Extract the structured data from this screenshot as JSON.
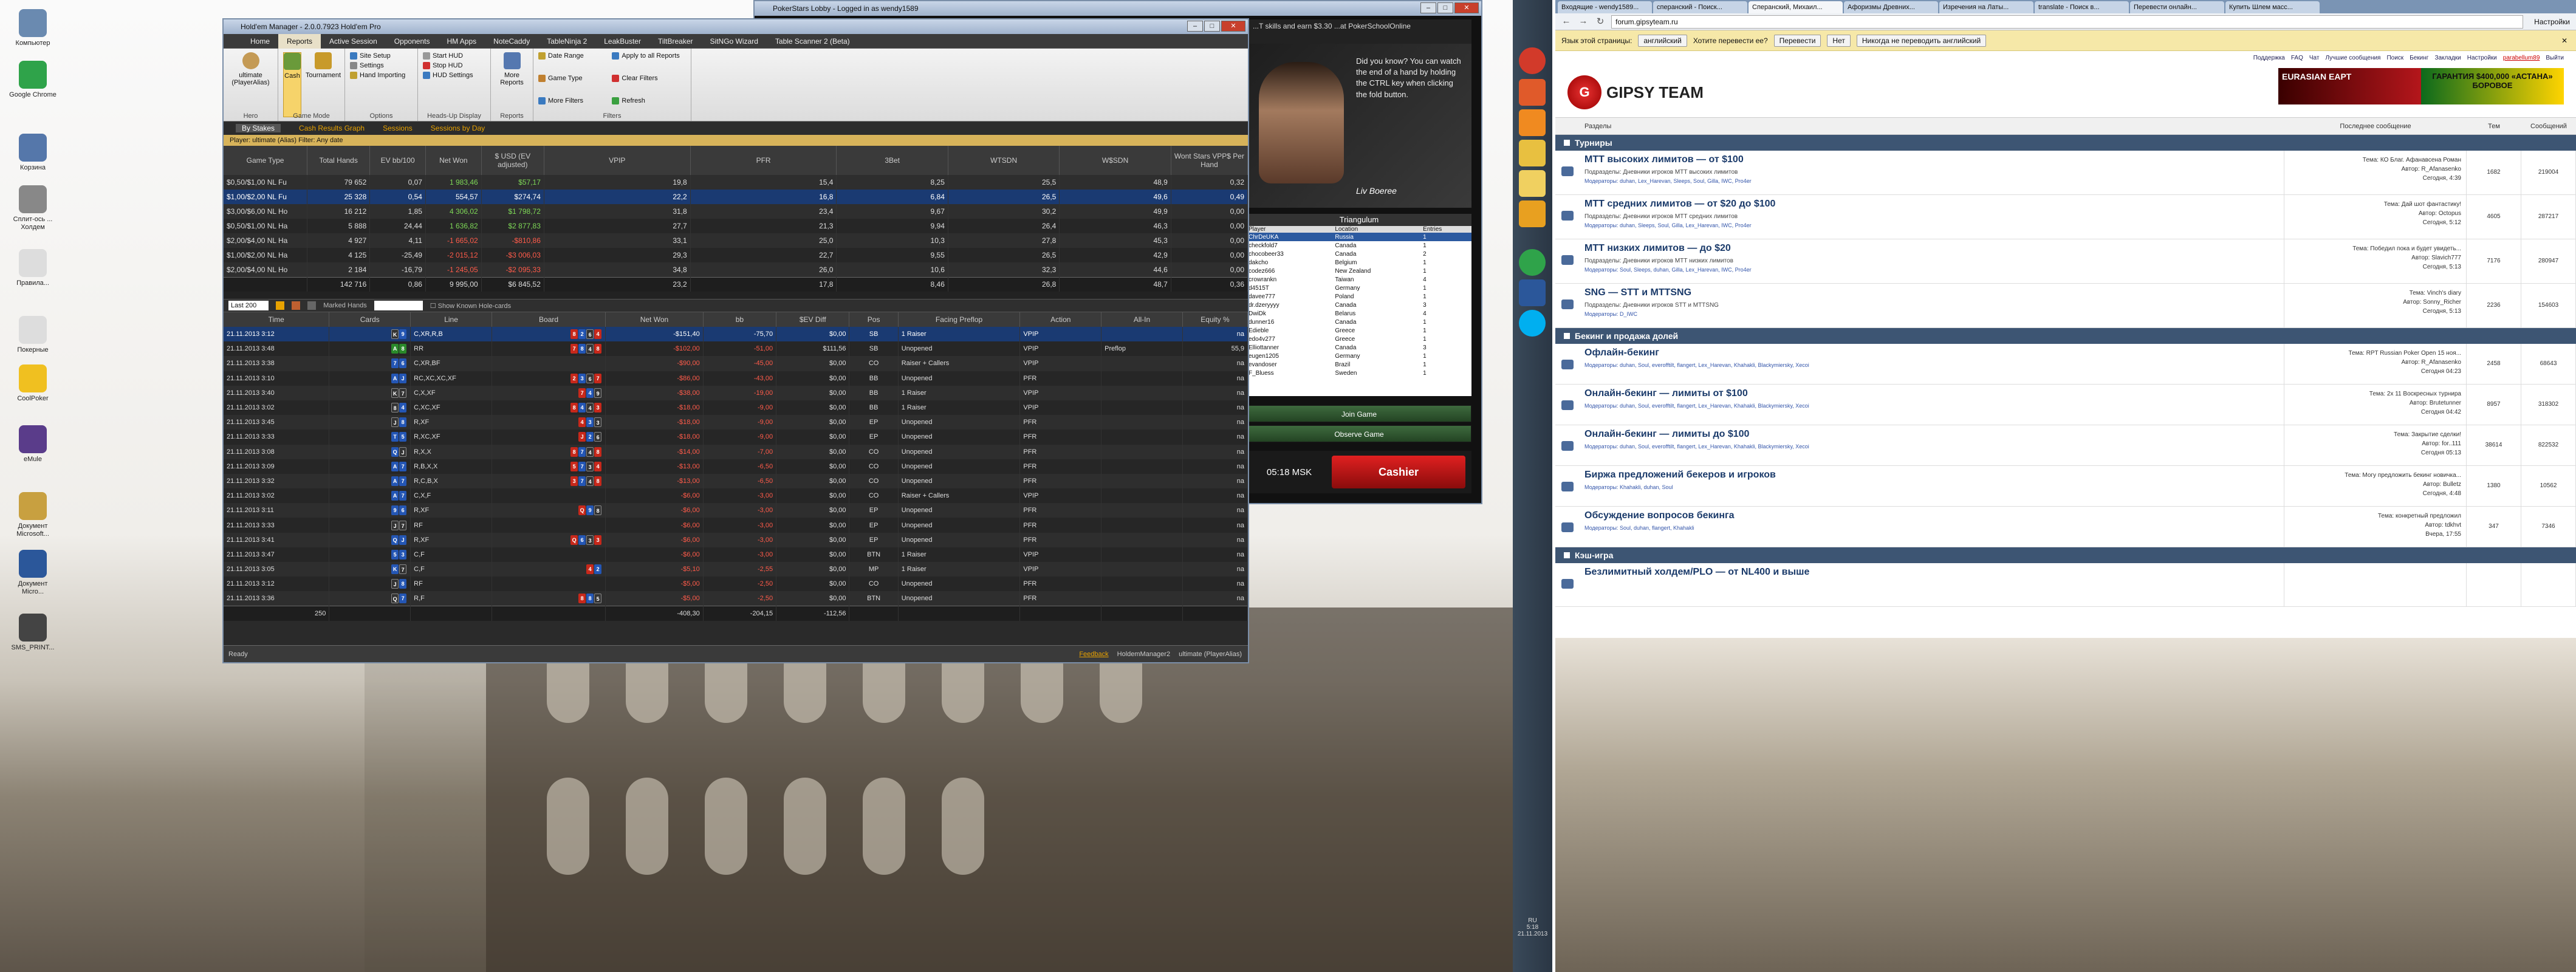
{
  "desktop": {
    "icons": [
      {
        "label": "Компьютер",
        "color": "#6a8ab0"
      },
      {
        "label": "Google Chrome",
        "color": "#2fa34a"
      },
      {
        "label": "Корзина",
        "color": "#5577aa"
      },
      {
        "label": "Сплит-ось ... Холдем",
        "color": "#888"
      },
      {
        "label": "Правила...",
        "color": "#ddd"
      },
      {
        "label": "Покерные",
        "color": "#ddd"
      },
      {
        "label": "CoolPoker",
        "color": "#f0c020"
      },
      {
        "label": "eMule",
        "color": "#5a3c8a"
      },
      {
        "label": "Документ Microsoft...",
        "color": "#c8a040"
      },
      {
        "label": "Документ Micro...",
        "color": "#2b579a"
      },
      {
        "label": "SMS_PRINT...",
        "color": "#444"
      }
    ]
  },
  "hem": {
    "title": "Hold'em Manager - 2.0.0.7923 Hold'em Pro",
    "menu": [
      "Home",
      "Reports",
      "Active Session",
      "Opponents",
      "HM Apps",
      "NoteCaddy",
      "TableNinja 2",
      "LeakBuster",
      "TiltBreaker",
      "SitNGo Wizard",
      "Table Scanner 2 (Beta)"
    ],
    "menu_active": "Reports",
    "ribbon": {
      "hero": {
        "name": "ultimate (PlayerAlias)",
        "caption": "Hero"
      },
      "modes": [
        "Cash",
        "Tournament"
      ],
      "modes_caption": "Game Mode",
      "options": [
        "Site Setup",
        "Settings",
        "Hand Importing"
      ],
      "options_caption": "Options",
      "hud": [
        "Start HUD",
        "Stop HUD",
        "HUD Settings"
      ],
      "hud_caption": "Heads-Up Display",
      "reports_btn": "More Reports",
      "reports_caption": "Reports",
      "filters": [
        "Date Range",
        "Apply to all Reports",
        "Game Type",
        "Clear Filters",
        "More Filters",
        "Refresh"
      ],
      "filters_caption": "Filters"
    },
    "subtabs": [
      "By Stakes",
      "Cash Results Graph",
      "Sessions",
      "Sessions by Day"
    ],
    "filter_text": "Player: ultimate (Alias)  Filter: Any date",
    "stakes_cols": [
      "Game Type",
      "Total Hands",
      "EV bb/100",
      "Net Won",
      "$ USD (EV adjusted)",
      "VPIP",
      "PFR",
      "3Bet",
      "WTSDN",
      "W$SDN",
      "Wont Stars VPP$ Per Hand"
    ],
    "stakes": [
      [
        "$0,50/$1,00 NL Fu",
        "79 652",
        "0,07",
        "1 983,46",
        "$57,17",
        "19,8",
        "15,4",
        "8,25",
        "25,5",
        "48,9",
        "0,32"
      ],
      [
        "$1,00/$2,00 NL Fu",
        "25 328",
        "0,54",
        "554,57",
        "$274,74",
        "22,2",
        "16,8",
        "6,84",
        "26,5",
        "49,6",
        "0,49"
      ],
      [
        "$3,00/$6,00 NL Ho",
        "16 212",
        "1,85",
        "4 306,02",
        "$1 798,72",
        "31,8",
        "23,4",
        "9,67",
        "30,2",
        "49,9",
        "0,00"
      ],
      [
        "$0,50/$1,00 NL Ha",
        "5 888",
        "24,44",
        "1 636,82",
        "$2 877,83",
        "27,7",
        "21,3",
        "9,94",
        "26,4",
        "46,3",
        "0,00"
      ],
      [
        "$2,00/$4,00 NL Ha",
        "4 927",
        "4,11",
        "-1 665,02",
        "-$810,86",
        "33,1",
        "25,0",
        "10,3",
        "27,8",
        "45,3",
        "0,00"
      ],
      [
        "$1,00/$2,00 NL Ha",
        "4 125",
        "-25,49",
        "-2 015,12",
        "-$3 006,03",
        "29,3",
        "22,7",
        "9,55",
        "26,5",
        "42,9",
        "0,00"
      ],
      [
        "$2,00/$4,00 NL Ho",
        "2 184",
        "-16,79",
        "-1 245,05",
        "-$2 095,33",
        "34,8",
        "26,0",
        "10,6",
        "32,3",
        "44,6",
        "0,00"
      ]
    ],
    "stakes_total": [
      "",
      "142 716",
      "0,86",
      "9 995,00",
      "$6 845,52",
      "23,2",
      "17,8",
      "8,46",
      "26,8",
      "48,7",
      "0,36"
    ],
    "hands_bar": {
      "range": "Last 200",
      "marked": "Marked Hands",
      "known": "Show Known Hole-cards"
    },
    "hands_cols": [
      "Time",
      "Cards",
      "Line",
      "Board",
      "Net Won",
      "bb",
      "$EV Diff",
      "Pos",
      "Facing Preflop",
      "Action",
      "All-In",
      "Equity %"
    ],
    "hands": [
      [
        "21.11.2013 3:12",
        "K♠ 9♦",
        "C,XR,R,B",
        "8 2 6 4",
        "-$151,40",
        "-75,70",
        "$0,00",
        "SB",
        "1 Raiser",
        "VPIP",
        "",
        "na"
      ],
      [
        "21.11.2013 3:48",
        "A♣ 8♣",
        "RR",
        "7 8 4 8",
        "-$102,00",
        "-51,00",
        "$111,56",
        "SB",
        "Unopened",
        "VPIP",
        "Preflop",
        "55,9"
      ],
      [
        "21.11.2013 3:38",
        "7♦ 6♦",
        "C,XR,BF",
        "",
        "-$90,00",
        "-45,00",
        "$0,00",
        "CO",
        "Raiser + Callers",
        "VPIP",
        "",
        "na"
      ],
      [
        "21.11.2013 3:10",
        "A♦ J♦",
        "RC,XC,XC,XF",
        "2 3 6 7",
        "-$86,00",
        "-43,00",
        "$0,00",
        "BB",
        "Unopened",
        "PFR",
        "",
        "na"
      ],
      [
        "21.11.2013 3:40",
        "K♠ 7♠",
        "C,X,XF",
        "7 4 9",
        "-$38,00",
        "-19,00",
        "$0,00",
        "BB",
        "1 Raiser",
        "VPIP",
        "",
        "na"
      ],
      [
        "21.11.2013 3:02",
        "8♠ 4♦",
        "C,XC,XF",
        "8 4 4 3",
        "-$18,00",
        "-9,00",
        "$0,00",
        "BB",
        "1 Raiser",
        "VPIP",
        "",
        "na"
      ],
      [
        "21.11.2013 3:45",
        "J♠ 8♦",
        "R,XF",
        "4 3 3",
        "-$18,00",
        "-9,00",
        "$0,00",
        "EP",
        "Unopened",
        "PFR",
        "",
        "na"
      ],
      [
        "21.11.2013 3:33",
        "T♦ 5♦",
        "R,XC,XF",
        "J 2 6",
        "-$18,00",
        "-9,00",
        "$0,00",
        "EP",
        "Unopened",
        "PFR",
        "",
        "na"
      ],
      [
        "21.11.2013 3:08",
        "Q♦ J♠",
        "R,X,X",
        "8 7 4 8",
        "-$14,00",
        "-7,00",
        "$0,00",
        "CO",
        "Unopened",
        "PFR",
        "",
        "na"
      ],
      [
        "21.11.2013 3:09",
        "A♦ 7♦",
        "R,B,X,X",
        "5 7 3 4",
        "-$13,00",
        "-6,50",
        "$0,00",
        "CO",
        "Unopened",
        "PFR",
        "",
        "na"
      ],
      [
        "21.11.2013 3:32",
        "A♦ 7♦",
        "R,C,B,X",
        "3 7 4 8",
        "-$13,00",
        "-6,50",
        "$0,00",
        "CO",
        "Unopened",
        "PFR",
        "",
        "na"
      ],
      [
        "21.11.2013 3:02",
        "A♦ 7♦",
        "C,X,F",
        "",
        "-$6,00",
        "-3,00",
        "$0,00",
        "CO",
        "Raiser + Callers",
        "VPIP",
        "",
        "na"
      ],
      [
        "21.11.2013 3:11",
        "9♦ 6♦",
        "R,XF",
        "Q 9 8",
        "-$6,00",
        "-3,00",
        "$0,00",
        "EP",
        "Unopened",
        "PFR",
        "",
        "na"
      ],
      [
        "21.11.2013 3:33",
        "J♠ 7♠",
        "RF",
        "",
        "-$6,00",
        "-3,00",
        "$0,00",
        "EP",
        "Unopened",
        "PFR",
        "",
        "na"
      ],
      [
        "21.11.2013 3:41",
        "Q♦ J♦",
        "R,XF",
        "Q 6 3 3",
        "-$6,00",
        "-3,00",
        "$0,00",
        "EP",
        "Unopened",
        "PFR",
        "",
        "na"
      ],
      [
        "21.11.2013 3:47",
        "5♦ 3♦",
        "C,F",
        "",
        "-$6,00",
        "-3,00",
        "$0,00",
        "BTN",
        "1 Raiser",
        "VPIP",
        "",
        "na"
      ],
      [
        "21.11.2013 3:05",
        "K♦ 7♠",
        "C,F",
        "4 2",
        "-$5,10",
        "-2,55",
        "$0,00",
        "MP",
        "1 Raiser",
        "VPIP",
        "",
        "na"
      ],
      [
        "21.11.2013 3:12",
        "J♠ 8♦",
        "RF",
        "",
        "-$5,00",
        "-2,50",
        "$0,00",
        "CO",
        "Unopened",
        "PFR",
        "",
        "na"
      ],
      [
        "21.11.2013 3:36",
        "Q♠ 7♦",
        "R,F",
        "8 8 5",
        "-$5,00",
        "-2,50",
        "$0,00",
        "BTN",
        "Unopened",
        "PFR",
        "",
        "na"
      ]
    ],
    "hands_total": [
      "250",
      "",
      "",
      "",
      "-408,30",
      "-204,15",
      "-112,56",
      "",
      "",
      "",
      "",
      ""
    ],
    "status": {
      "left": "Ready",
      "feedback": "Feedback",
      "app": "HoldemManager2",
      "user": "ultimate (PlayerAlias)"
    }
  },
  "ps": {
    "title": "PokerStars Lobby - Logged in as wendy1589",
    "top_ad": "...T skills and earn $3.30 ...at PokerSchoolOnline",
    "ad": "Did you know? You can watch the end of a hand by holding the CTRL key when clicking the fold button.",
    "ad_sig": "Liv Boeree",
    "tourn_title": "Triangulum",
    "tourn_cols": [
      "Player",
      "Location",
      "Entries"
    ],
    "tourn_rows": [
      [
        "ChrDeUKA",
        "Russia",
        "1"
      ],
      [
        "checkfold7",
        "Canada",
        "1"
      ],
      [
        "chocobeer33",
        "Canada",
        "2"
      ],
      [
        "dakcho",
        "Belgium",
        "1"
      ],
      [
        "codez666",
        "New Zealand",
        "1"
      ],
      [
        "crowrankn",
        "Taiwan",
        "4"
      ],
      [
        "d4515T",
        "Germany",
        "1"
      ],
      [
        "davee777",
        "Poland",
        "1"
      ],
      [
        "dr.dzeryyyy",
        "Canada",
        "3"
      ],
      [
        "DwiDk",
        "Belarus",
        "4"
      ],
      [
        "dunner16",
        "Canada",
        "1"
      ],
      [
        "Edieble",
        "Greece",
        "1"
      ],
      [
        "edo4v277",
        "Greece",
        "1"
      ],
      [
        "Elliottanner",
        "Canada",
        "3"
      ],
      [
        "eugen1205",
        "Germany",
        "1"
      ],
      [
        "evandoser",
        "Brazil",
        "1"
      ],
      [
        "F_Bluess",
        "Sweden",
        "1"
      ]
    ],
    "join": "Join Game",
    "observe": "Observe Game",
    "clock": "05:18 MSK",
    "cashier": "Cashier"
  },
  "tray": {
    "lang": "RU",
    "time": "5:18",
    "date": "21.11.2013"
  },
  "browser": {
    "tabs": [
      "Входящие - wendy1589...",
      "сперанский - Поиск...",
      "Сперанский, Михаил...",
      "Афоризмы Древних...",
      "Изречения на Латы...",
      "translate - Поиск в...",
      "Перевести онлайн...",
      "Купить Шлем масс..."
    ],
    "active_tab": 2,
    "url": "forum.gipsyteam.ru",
    "settings": "Настройки",
    "translate": {
      "q": "Язык этой страницы:",
      "lang": "английский",
      "ask": "Хотите перевести ее?",
      "yes": "Перевести",
      "no": "Нет",
      "never": "Никогда не переводить английский"
    },
    "nav": [
      "Поддержка",
      "FAQ",
      "Чат",
      "Лучшие сообщения",
      "Поиск",
      "Бекинг",
      "Закладки",
      "Настройки",
      "parabellum89",
      "Выйти"
    ],
    "logo": "GIPSY TEAM",
    "banner_a": "EURASIAN EAPT",
    "banner_b": "ГАРАНТИЯ $400,000 «АСТАНА» БОРОВОЕ",
    "cols": [
      "Разделы",
      "Последнее сообщение",
      "Тем",
      "Сообщений"
    ],
    "sections": [
      {
        "title": "Турниры",
        "rows": [
          {
            "t": "МТТ высоких лимитов — от $100",
            "d": "Подразделы: Дневники игроков МТТ высоких лимитов",
            "m": "Модераторы: duhan, Lex_Harevan, Sleeps, Soul, Gilla, IWC, Pro4er",
            "l": "Тема: КО Благ. Афанавсена Роман",
            "a": "Автор: R_Afanasenko",
            "w": "Сегодня, 4:39",
            "n1": "1682",
            "n2": "219004"
          },
          {
            "t": "МТТ средних лимитов — от $20 до $100",
            "d": "Подразделы: Дневники игроков МТТ средних лимитов",
            "m": "Модераторы: duhan, Sleeps, Soul, Gilla, Lex_Harevan, IWC, Pro4er",
            "l": "Тема: Дай шот фантастику!",
            "a": "Автор: Octopus",
            "w": "Сегодня, 5:12",
            "n1": "4605",
            "n2": "287217"
          },
          {
            "t": "МТТ низких лимитов — до $20",
            "d": "Подразделы: Дневники игроков МТТ низких лимитов",
            "m": "Модераторы: Soul, Sleeps, duhan, Gilla, Lex_Harevan, IWC, Pro4er",
            "l": "Тема: Победил пока и будет увидеть...",
            "a": "Автор: Slavich777",
            "w": "Сегодня, 5:13",
            "n1": "7176",
            "n2": "280947"
          },
          {
            "t": "SNG — STT и MTTSNG",
            "d": "Подразделы: Дневники игроков STT и MTTSNG",
            "m": "Модераторы: D_IWC",
            "l": "Тема: Vinch's diary",
            "a": "Автор: Sonny_Richer",
            "w": "Сегодня, 5:13",
            "n1": "2236",
            "n2": "154603"
          }
        ]
      },
      {
        "title": "Бекинг и продажа долей",
        "rows": [
          {
            "t": "Офлайн-бекинг",
            "d": "",
            "m": "Модераторы: duhan, Soul, everofftilt, flangert, Lex_Harevan, Khahakli, Blackymiersky, Xecoi",
            "l": "Тема: RPT Russian Poker Open 15 ноя...",
            "a": "Автор: R_Afanasenko",
            "w": "Сегодня 04:23",
            "n1": "2458",
            "n2": "68643"
          },
          {
            "t": "Онлайн-бекинг — лимиты от $100",
            "d": "",
            "m": "Модераторы: duhan, Soul, everofftilt, flangert, Lex_Harevan, Khahakli, Blackymiersky, Xecoi",
            "l": "Тема: 2х 11 Воскресных турнира",
            "a": "Автор: Brutetunner",
            "w": "Сегодня 04:42",
            "n1": "8957",
            "n2": "318302"
          },
          {
            "t": "Онлайн-бекинг — лимиты до $100",
            "d": "",
            "m": "Модераторы: duhan, Soul, everofftilt, flangert, Lex_Harevan, Khahakli, Blackymiersky, Xecoi",
            "l": "Тема: Закрытие сделки!",
            "a": "Автор: for..111",
            "w": "Сегодня 05:13",
            "n1": "38614",
            "n2": "822532"
          },
          {
            "t": "Биржа предложений бекеров и игроков",
            "d": "",
            "m": "Модераторы: Khahakli, duhan, Soul",
            "l": "Тема: Могу предложить бекинг новичка...",
            "a": "Автор: Bulletz",
            "w": "Сегодня, 4:48",
            "n1": "1380",
            "n2": "10562"
          },
          {
            "t": "Обсуждение вопросов бекинга",
            "d": "",
            "m": "Модераторы: Soul, duhan, flangert, Khahakli",
            "l": "Тема: конкретный предложил",
            "a": "Автор: tdkhvt",
            "w": "Вчера, 17:55",
            "n1": "347",
            "n2": "7346"
          }
        ]
      },
      {
        "title": "Кэш-игра",
        "rows": [
          {
            "t": "Безлимитный холдем/PLO — от NL400 и выше",
            "d": "",
            "m": "",
            "l": "",
            "a": "",
            "w": "",
            "n1": "",
            "n2": ""
          }
        ]
      }
    ]
  }
}
